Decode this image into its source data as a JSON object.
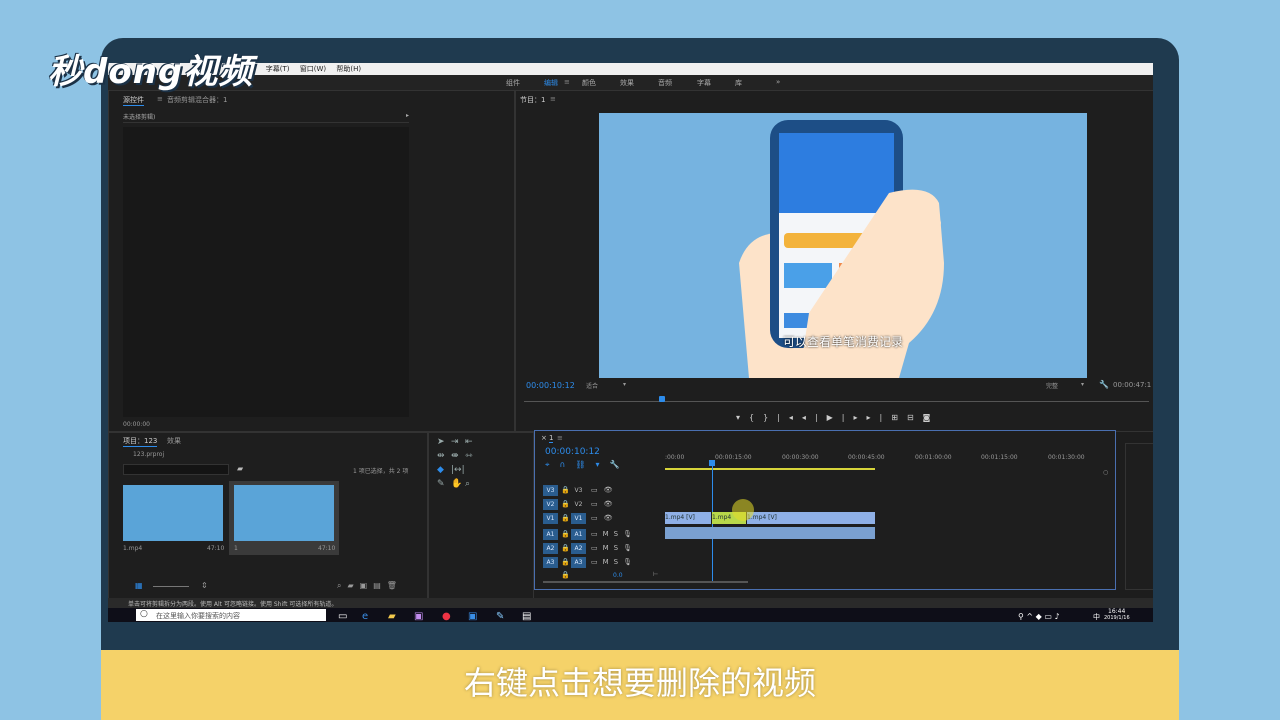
{
  "brand": {
    "logo": "秒dong视频"
  },
  "caption": "右键点击想要删除的视频",
  "menu": [
    "标记(M)",
    "字幕(T)",
    "窗口(W)",
    "帮助(H)"
  ],
  "workspaces": [
    "组件",
    "编辑",
    "颜色",
    "效果",
    "音频",
    "字幕",
    "库",
    "»"
  ],
  "source_panel": {
    "tab1": "源控件",
    "tab2": "音频剪辑混合器：1",
    "dropdown": "未选择剪辑)",
    "timecode": "00:00:00"
  },
  "program": {
    "label": "节目：1",
    "timecode": "00:00:10:12",
    "fit": "适合",
    "quality": "完整",
    "duration": "00:00:47:1",
    "video_caption": "可以查看单笔消费记录"
  },
  "project": {
    "tab1": "项目：123",
    "tab2": "效果",
    "file": "123.prproj",
    "selection": "1 项已选择，共 2 项",
    "thumb1_name": "1.mp4",
    "thumb1_dur": "47:10",
    "thumb2_name": "1",
    "thumb2_dur": "47:10"
  },
  "timeline": {
    "seq": "1",
    "timecode": "00:00:10:12",
    "ruler": [
      ":00:00",
      "00:00:15:00",
      "00:00:30:00",
      "00:00:45:00",
      "00:01:00:00",
      "00:01:15:00",
      "00:01:30:00"
    ],
    "video_tracks": [
      "V3",
      "V2",
      "V1"
    ],
    "audio_tracks": [
      "A1",
      "A2",
      "A3"
    ],
    "clip1": "1.mp4 [V]",
    "clip2": "1.mp4",
    "clip3": "1.mp4 [V]",
    "master": "0.0"
  },
  "status_bar": "单击可将剪辑拆分为两段。使用 Alt 可忽略链接。使用 Shift 可选择所有轨道。",
  "taskbar": {
    "search_placeholder": "在这里输入你要搜索的内容",
    "time": "16:44",
    "date": "2019/1/16",
    "lang": "中"
  },
  "colors": {
    "accent": "#2d8ceb",
    "caption_bar": "#f5d269",
    "bezel": "#1f3a4f"
  }
}
